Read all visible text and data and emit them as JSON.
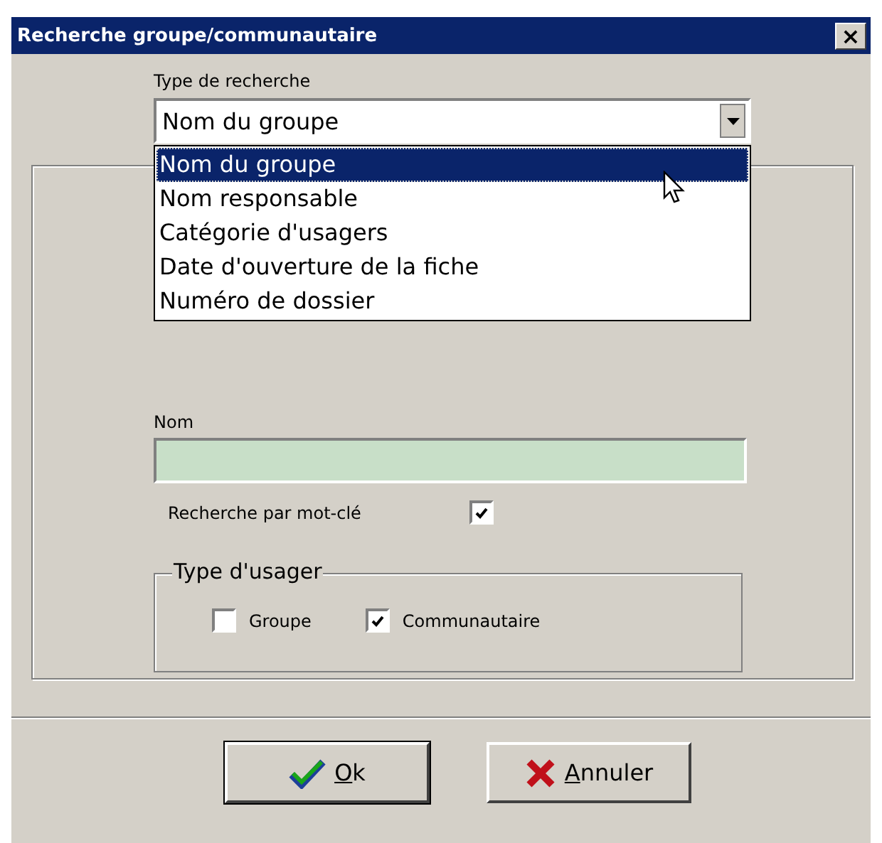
{
  "window": {
    "title": "Recherche groupe/communautaire",
    "close": "×"
  },
  "search_type": {
    "label": "Type de recherche",
    "value": "Nom du groupe",
    "expanded": true,
    "options": [
      {
        "label": "Nom du groupe",
        "selected": true
      },
      {
        "label": "Nom responsable",
        "selected": false
      },
      {
        "label": "Catégorie d'usagers",
        "selected": false
      },
      {
        "label": "Date d'ouverture de la fiche",
        "selected": false
      },
      {
        "label": "Numéro de dossier",
        "selected": false
      }
    ]
  },
  "name_field": {
    "label": "Nom"
  },
  "keyword_search": {
    "label": "Recherche par mot-clé",
    "checked": true
  },
  "user_type": {
    "legend": "Type d'usager",
    "options": [
      {
        "label": "Groupe",
        "checked": false
      },
      {
        "label": "Communautaire",
        "checked": true
      }
    ]
  },
  "buttons": [
    {
      "kind": "ok",
      "label": "Ok",
      "default": true
    },
    {
      "kind": "cancel",
      "label": "Annuler",
      "default": false
    }
  ]
}
